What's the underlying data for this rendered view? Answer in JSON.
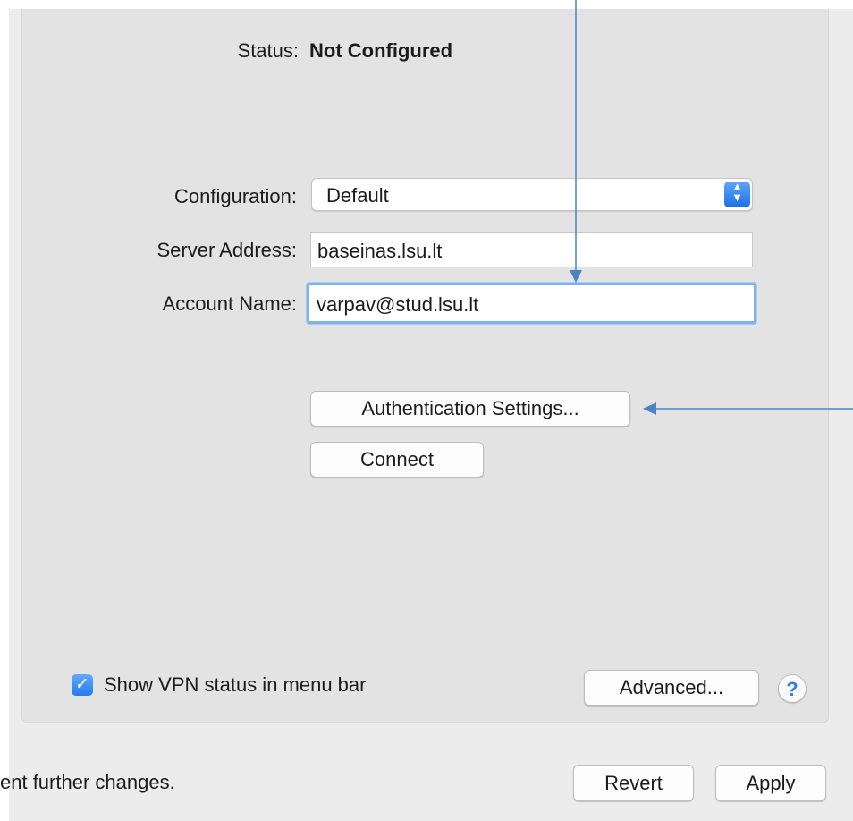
{
  "status": {
    "label": "Status:",
    "value": "Not Configured"
  },
  "form": {
    "configuration_label": "Configuration:",
    "configuration_value": "Default",
    "server_label": "Server Address:",
    "server_value": "baseinas.lsu.lt",
    "account_label": "Account Name:",
    "account_value": "varpav@stud.lsu.lt"
  },
  "buttons": {
    "auth_settings": "Authentication Settings...",
    "connect": "Connect",
    "advanced": "Advanced...",
    "help": "?",
    "revert": "Revert",
    "apply": "Apply"
  },
  "menu_bar_option": {
    "label": "Show VPN status in menu bar",
    "checked": true
  },
  "footer": {
    "lock_text": "ent further changes."
  },
  "colors": {
    "accent": "#2f7fe9",
    "annotation_arrow": "#4a83c4"
  },
  "icons": {
    "stepper": "chevron-up-down-icon",
    "check": "checkmark-icon",
    "help": "question-icon"
  }
}
